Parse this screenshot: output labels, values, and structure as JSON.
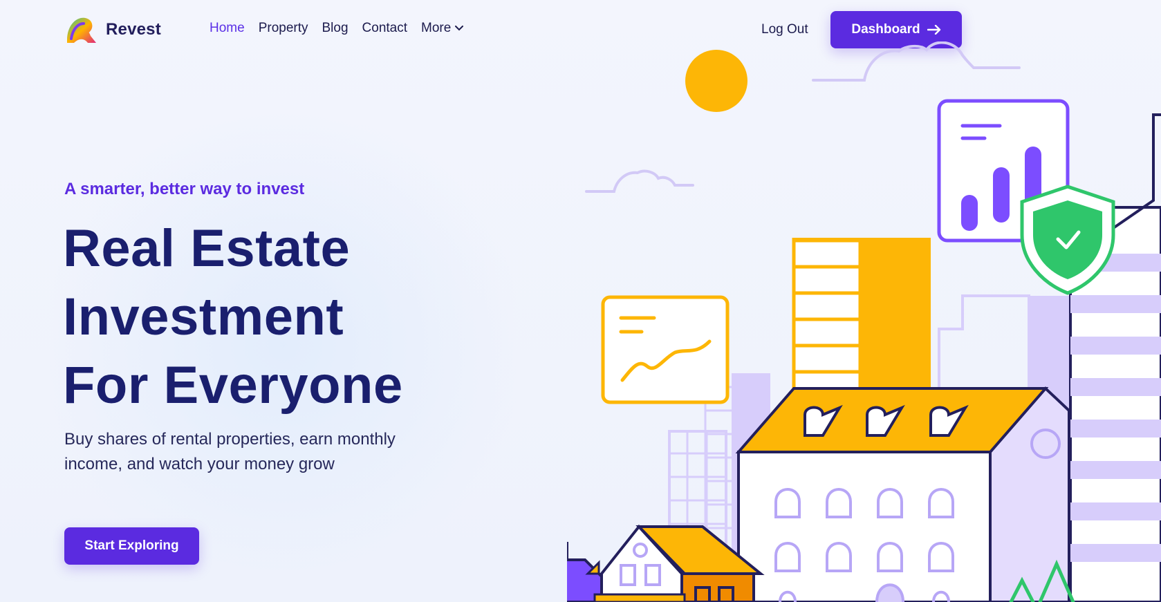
{
  "brand": {
    "name": "Revest",
    "logo_icon": "revest-logo-icon"
  },
  "nav": {
    "items": [
      {
        "label": "Home",
        "active": true
      },
      {
        "label": "Property",
        "active": false
      },
      {
        "label": "Blog",
        "active": false
      },
      {
        "label": "Contact",
        "active": false
      },
      {
        "label": "More",
        "active": false,
        "icon": "chevron-down-icon"
      }
    ],
    "logout_label": "Log Out",
    "dashboard_label": "Dashboard",
    "dashboard_icon": "arrow-right-icon"
  },
  "hero": {
    "tagline": "A smarter, better way to invest",
    "headline": [
      "Real Estate",
      "Investment",
      "For Everyone"
    ],
    "subtext": "Buy shares of rental properties, earn monthly income, and watch your money grow",
    "cta_label": "Start Exploring"
  },
  "colors": {
    "accent": "#5b2be0",
    "heading": "#1a1f6e",
    "yellow": "#fdb606",
    "lavender": "#d9d0fb",
    "green": "#2fc66b"
  }
}
